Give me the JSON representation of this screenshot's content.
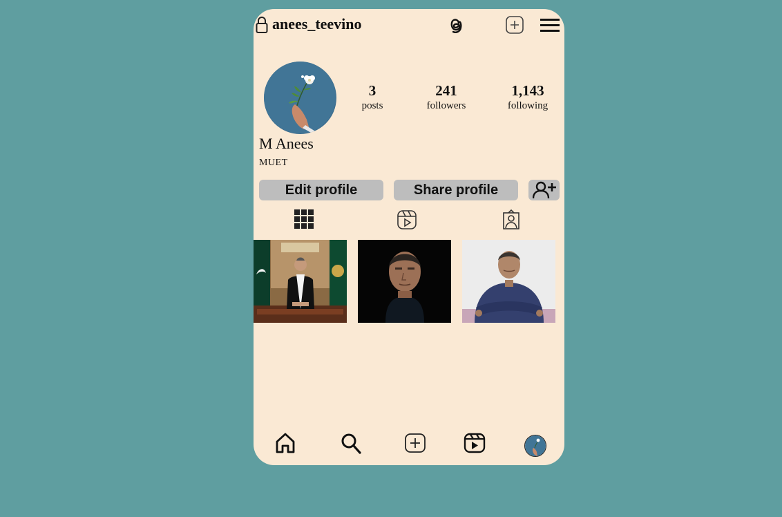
{
  "header": {
    "username": "anees_teevino",
    "icons": [
      "lock-icon",
      "threads-icon",
      "new-post-icon",
      "menu-icon"
    ]
  },
  "profile": {
    "stats": [
      {
        "value": "3",
        "label": "posts"
      },
      {
        "value": "241",
        "label": "followers"
      },
      {
        "value": "1,143",
        "label": "following"
      }
    ],
    "display_name": "M Anees",
    "bio": "MUET"
  },
  "actions": {
    "edit_label": "Edit profile",
    "share_label": "Share profile",
    "add_user_icon": "add-user-icon"
  },
  "tabs": [
    "grid-icon",
    "reels-icon",
    "tagged-icon"
  ],
  "posts_count": 3,
  "bottom_nav": [
    "home-icon",
    "search-icon",
    "create-icon",
    "reels-icon",
    "profile-avatar"
  ],
  "colors": {
    "background": "#5f9ea0",
    "card": "#fae9d4",
    "button": "#bdbdbd"
  }
}
